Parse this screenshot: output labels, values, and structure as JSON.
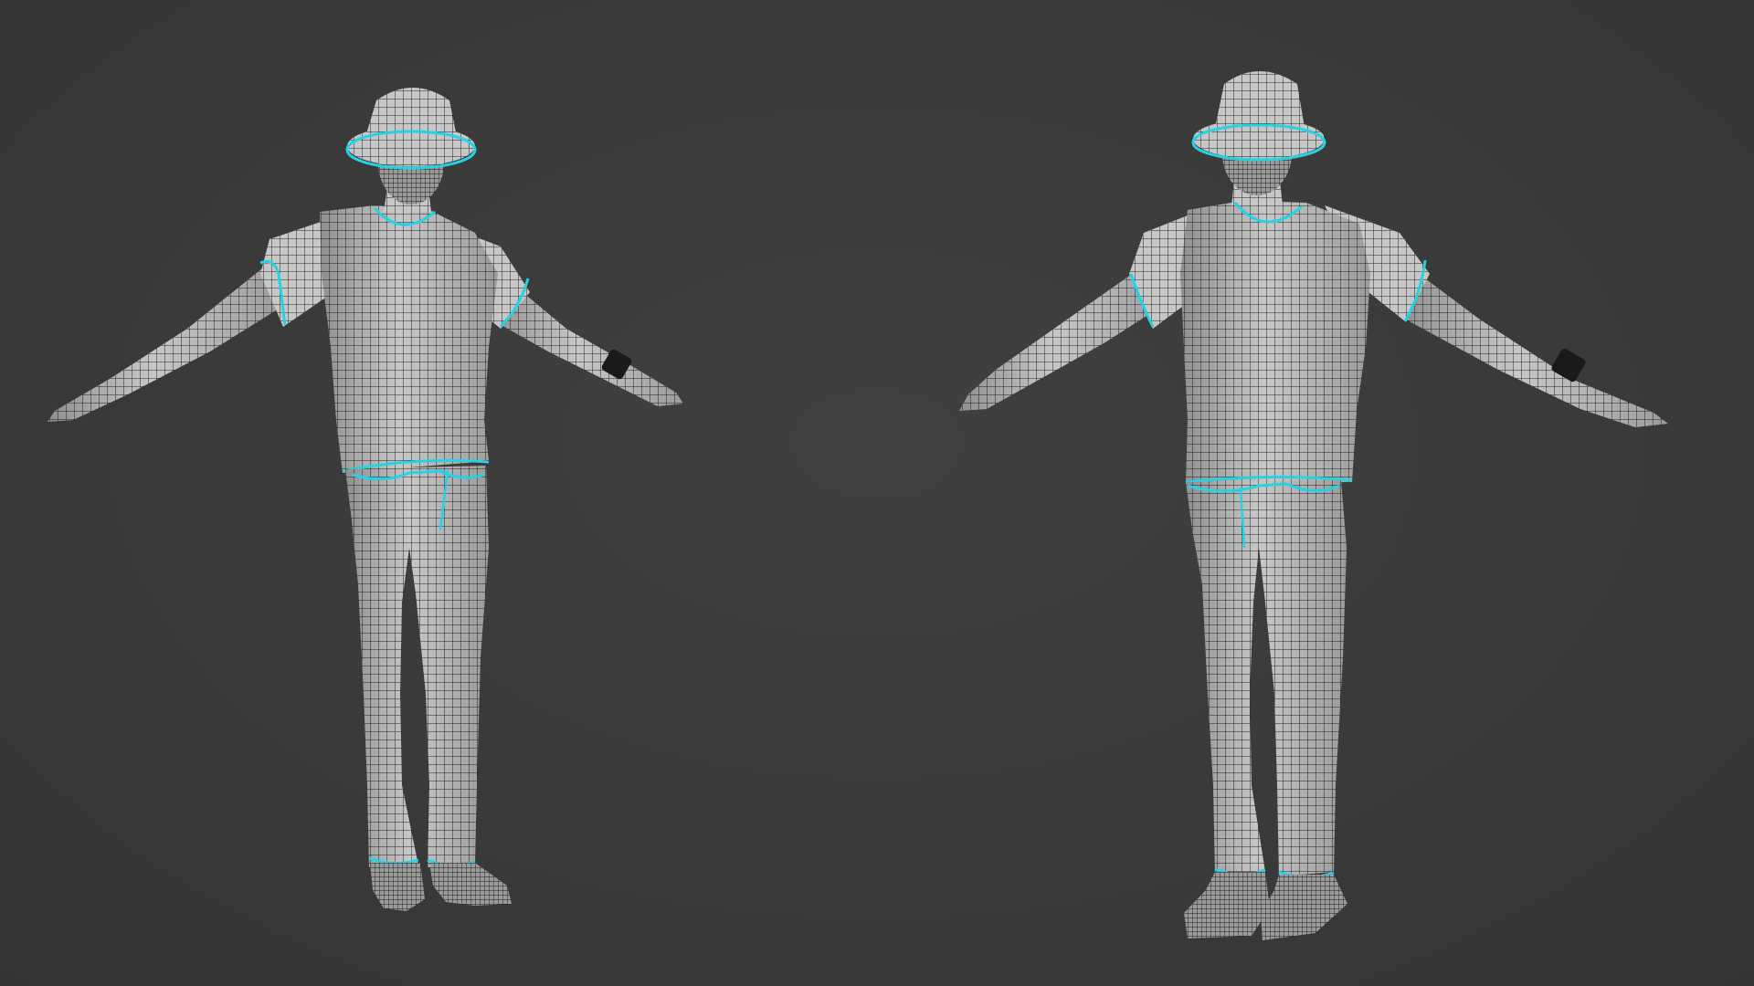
{
  "viewport": {
    "background_color": "#3a3a3a"
  },
  "colors": {
    "mesh_fill": "#c9c9c9",
    "mesh_shadow": "#8f8f8f",
    "wire": "#1e1e1e",
    "seam": "#22d3e6",
    "watch": "#1a1a1a"
  },
  "models": [
    {
      "name": "character-mesh",
      "variant": "low-density-shoes"
    },
    {
      "name": "character-mesh",
      "variant": "high-density-shoes"
    }
  ]
}
